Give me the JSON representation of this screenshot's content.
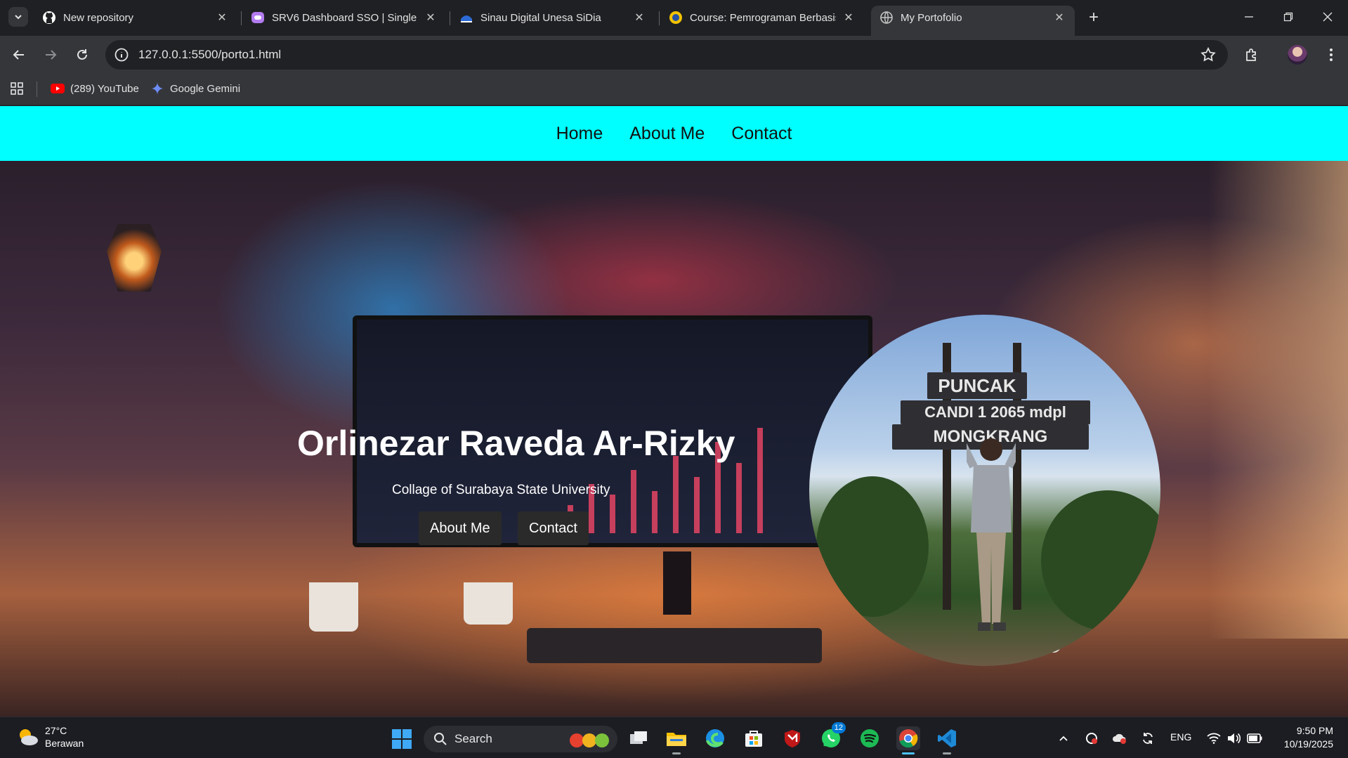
{
  "browser": {
    "tabs": [
      {
        "title": "New repository",
        "icon": "github-icon"
      },
      {
        "title": "SRV6 Dashboard SSO | Single S",
        "icon": "srv6-icon"
      },
      {
        "title": "Sinau Digital Unesa SiDia",
        "icon": "sidia-icon"
      },
      {
        "title": "Course: Pemrograman Berbasis",
        "icon": "unesa-icon"
      },
      {
        "title": "My Portofolio",
        "icon": "globe-icon",
        "active": true
      }
    ],
    "url": "127.0.0.1:5500/porto1.html",
    "bookmarks": [
      {
        "label": "(289) YouTube",
        "icon": "youtube-icon"
      },
      {
        "label": "Google Gemini",
        "icon": "gemini-icon"
      }
    ]
  },
  "site": {
    "nav": [
      "Home",
      "About Me",
      "Contact"
    ],
    "hero": {
      "name": "Orlinezar Raveda Ar-Rizky",
      "subtitle": "Collage of Surabaya State University",
      "buttons": [
        "About Me",
        "Contact"
      ]
    },
    "profile_sign": {
      "line1": "PUNCAK",
      "line2": "CANDI 1 2065 mdpl",
      "line3": "MONGKRANG"
    }
  },
  "taskbar": {
    "weather": {
      "temp": "27°C",
      "desc": "Berawan"
    },
    "search_label": "Search",
    "whatsapp_badge": "12",
    "lang": "ENG",
    "time": "9:50 PM",
    "date": "10/19/2025"
  },
  "colors": {
    "nav_bg": "#00ffff",
    "chrome_bg": "#35363a",
    "taskbar_bg": "#1c1d22"
  }
}
